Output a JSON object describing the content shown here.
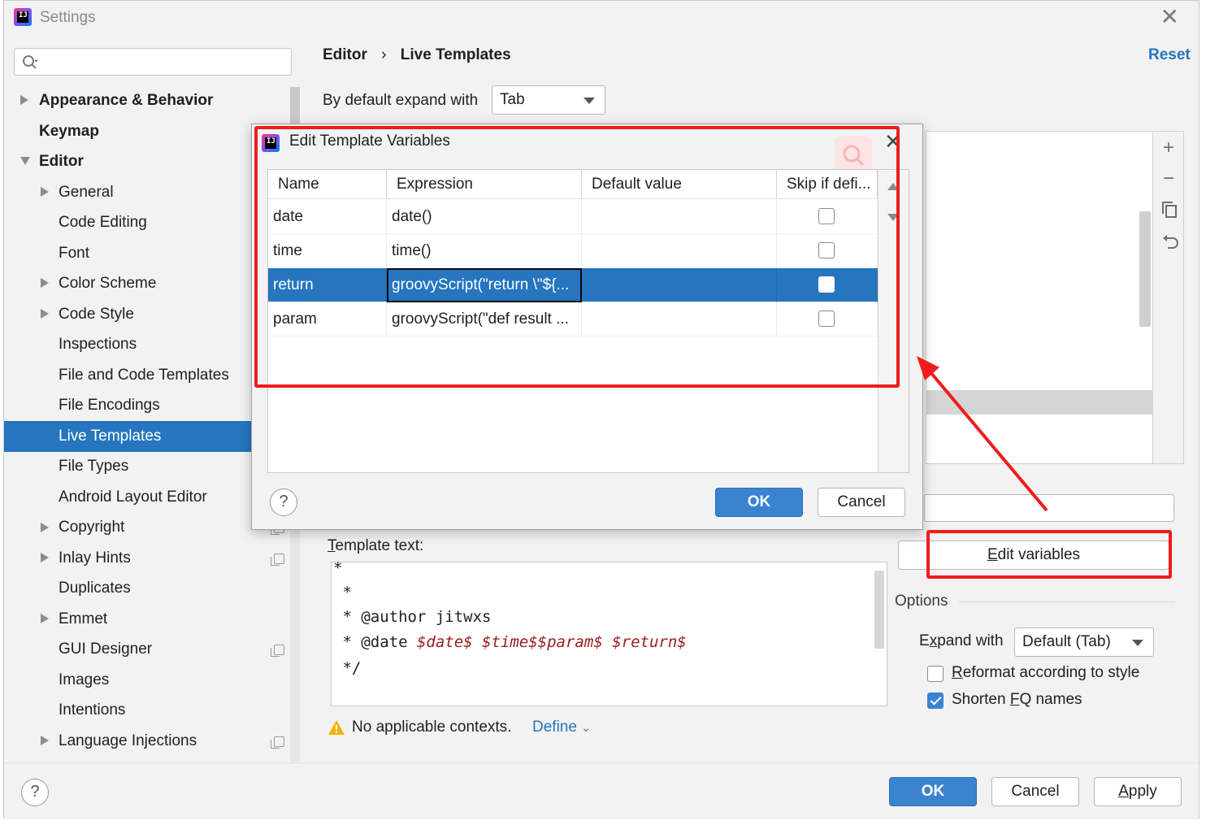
{
  "window": {
    "title": "Settings"
  },
  "search": {
    "placeholder": ""
  },
  "tree": {
    "appearance": "Appearance & Behavior",
    "keymap": "Keymap",
    "editor": "Editor",
    "general": "General",
    "code_editing": "Code Editing",
    "font": "Font",
    "color_scheme": "Color Scheme",
    "code_style": "Code Style",
    "inspections": "Inspections",
    "file_code_templates": "File and Code Templates",
    "file_encodings": "File Encodings",
    "live_templates": "Live Templates",
    "file_types": "File Types",
    "android_layout": "Android Layout Editor",
    "copyright": "Copyright",
    "inlay_hints": "Inlay Hints",
    "duplicates": "Duplicates",
    "emmet": "Emmet",
    "gui_designer": "GUI Designer",
    "images": "Images",
    "intentions": "Intentions",
    "language_injections": "Language Injections"
  },
  "breadcrumb": {
    "parent": "Editor",
    "sep": "›",
    "current": "Live Templates"
  },
  "reset_label": "Reset",
  "expand_default": {
    "label": "By default expand with",
    "value": "Tab"
  },
  "template_text": {
    "label_u": "T",
    "label_rest": "emplate text:",
    "line1": "*",
    "line2": " *",
    "line3": " * @author jitwxs",
    "line4_prefix": " * @date ",
    "var_date": "$date$",
    "var_time_param": "$time$$param$",
    "var_return": "$return$",
    "line5": " */"
  },
  "warning": {
    "text": "No applicable contexts.",
    "define": "Define"
  },
  "edit_variables": {
    "u": "E",
    "rest": "dit variables"
  },
  "options": {
    "title": "Options",
    "expand_with_u": "x",
    "expand_with_pre": "E",
    "expand_with_post": "pand with",
    "expand_with_value": "Default (Tab)",
    "reformat_u": "R",
    "reformat_rest": "eformat according to style",
    "reformat_checked": false,
    "shorten_pre": "Shorten ",
    "shorten_u": "F",
    "shorten_post": "Q names",
    "shorten_checked": true
  },
  "footer": {
    "ok": "OK",
    "cancel": "Cancel",
    "apply_u": "A",
    "apply_rest": "pply",
    "help": "?"
  },
  "dialog": {
    "title": "Edit Template Variables",
    "columns": [
      "Name",
      "Expression",
      "Default value",
      "Skip if defi..."
    ],
    "rows": [
      {
        "name": "date",
        "expression": "date()",
        "default": "",
        "skip": false
      },
      {
        "name": "time",
        "expression": "time()",
        "default": "",
        "skip": false
      },
      {
        "name": "return",
        "expression": "groovyScript(\"return \\\"${...",
        "default": "",
        "skip": false
      },
      {
        "name": "param",
        "expression": "groovyScript(\"def result ...",
        "default": "",
        "skip": false
      }
    ],
    "selected_row": "return",
    "ok": "OK",
    "cancel": "Cancel",
    "help": "?"
  },
  "colors": {
    "accent": "#2675bf",
    "annotation_red": "#f01c1c",
    "variable": "#9b1b1b"
  }
}
